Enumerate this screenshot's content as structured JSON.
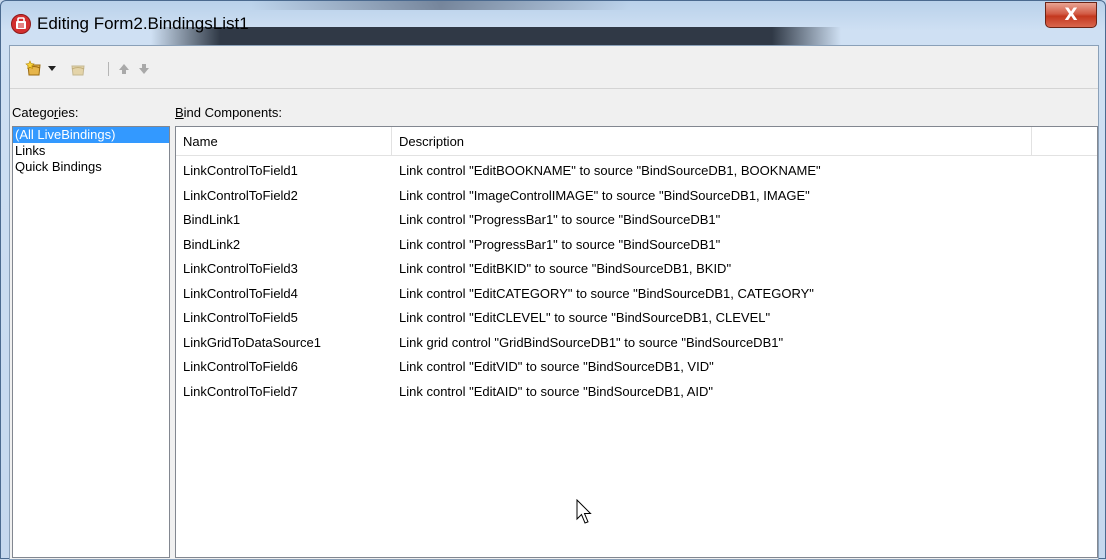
{
  "window": {
    "title": "Editing Form2.BindingsList1",
    "close_label": "X"
  },
  "toolbar": {
    "items": [
      {
        "icon": "new-binding-icon"
      },
      {
        "icon": "dropdown-arrow-icon"
      },
      {
        "icon": "delete-binding-icon"
      },
      {
        "icon": "move-up-icon"
      },
      {
        "icon": "move-down-icon"
      }
    ]
  },
  "categories": {
    "label_prefix": "Catego",
    "label_underlined": "r",
    "label_suffix": "ies:",
    "items": [
      {
        "label": "(All LiveBindings)",
        "selected": true
      },
      {
        "label": "Links",
        "selected": false
      },
      {
        "label": "Quick Bindings",
        "selected": false
      }
    ]
  },
  "bind_components": {
    "label_underlined": "B",
    "label_rest": "ind Components:",
    "columns": [
      "Name",
      "Description"
    ],
    "rows": [
      {
        "name": "LinkControlToField1",
        "description": "Link control \"EditBOOKNAME\" to source \"BindSourceDB1, BOOKNAME\""
      },
      {
        "name": "LinkControlToField2",
        "description": "Link control \"ImageControlIMAGE\" to source \"BindSourceDB1, IMAGE\""
      },
      {
        "name": "BindLink1",
        "description": "Link control \"ProgressBar1\" to source \"BindSourceDB1\""
      },
      {
        "name": "BindLink2",
        "description": "Link control \"ProgressBar1\" to source \"BindSourceDB1\""
      },
      {
        "name": "LinkControlToField3",
        "description": "Link control \"EditBKID\" to source \"BindSourceDB1, BKID\""
      },
      {
        "name": "LinkControlToField4",
        "description": "Link control \"EditCATEGORY\" to source \"BindSourceDB1, CATEGORY\""
      },
      {
        "name": "LinkControlToField5",
        "description": "Link control \"EditCLEVEL\" to source \"BindSourceDB1, CLEVEL\""
      },
      {
        "name": "LinkGridToDataSource1",
        "description": "Link grid control \"GridBindSourceDB1\" to source \"BindSourceDB1\""
      },
      {
        "name": "LinkControlToField6",
        "description": "Link control \"EditVID\" to source \"BindSourceDB1, VID\""
      },
      {
        "name": "LinkControlToField7",
        "description": "Link control \"EditAID\" to source \"BindSourceDB1, AID\""
      }
    ]
  },
  "colors": {
    "selection": "#3399ff",
    "close_button": "#c3381f",
    "app_icon": "#d32f2f"
  }
}
